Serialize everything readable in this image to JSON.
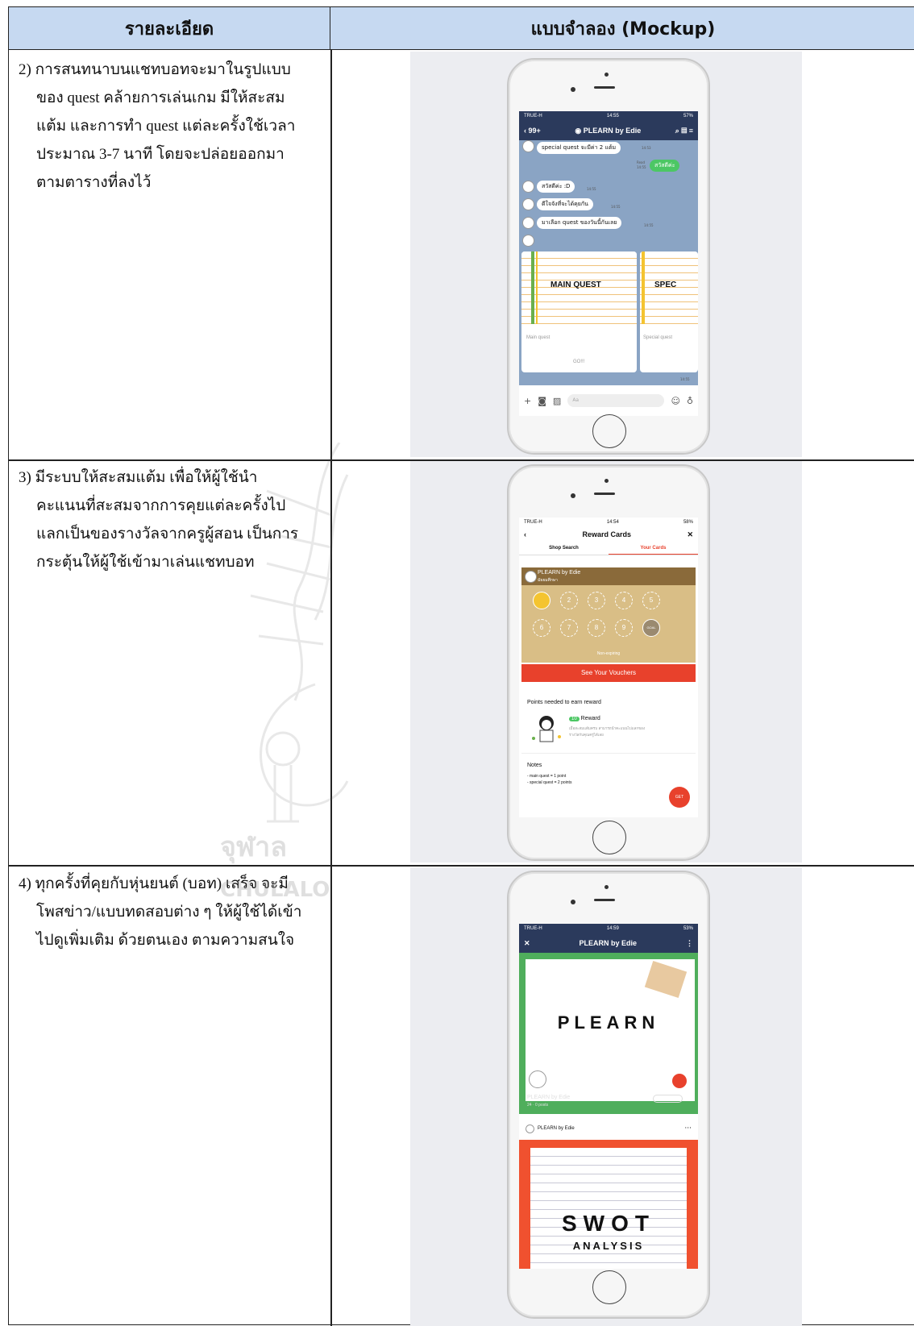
{
  "table": {
    "header_detail": "รายละเอียด",
    "header_mockup": "แบบจำลอง (Mockup)"
  },
  "rows": [
    {
      "lines": [
        "2) การสนทนาบนแชทบอทจะมาในรูปแบบ",
        "ของ quest คล้ายการเล่นเกม มีให้สะสม",
        "แต้ม และการทำ quest แต่ละครั้งใช้เวลา",
        "ประมาณ 3-7 นาที โดยจะปล่อยออกมา",
        "ตามตารางที่ลงไว้"
      ]
    },
    {
      "lines": [
        "3) มีระบบให้สะสมแต้ม เพื่อให้ผู้ใช้นำ",
        "คะแนนที่สะสมจากการคุยแต่ละครั้งไป",
        "แลกเป็นของรางวัลจากครูผู้สอน เป็นการ",
        "กระตุ้นให้ผู้ใช้เข้ามาเล่นแชทบอท"
      ]
    },
    {
      "lines": [
        "4) ทุกครั้งที่คุยกับหุ่นยนต์ (บอท) เสร็จ จะมี",
        "โพสข่าว/แบบทดสอบต่าง ๆ ให้ผู้ใช้ได้เข้า",
        "ไปดูเพิ่มเติม ด้วยตนเอง ตามความสนใจ"
      ]
    }
  ],
  "watermark": {
    "thai": "จุฬาล",
    "eng": "CHULALO"
  },
  "phone1": {
    "carrier": "TRUE-H",
    "time": "14:55",
    "battery": "57%",
    "back": "99+",
    "title": "PLEARN by Edie",
    "msg_top": "special quest จะมีค่า 2 แต้ม",
    "msg_top_time": "14:53",
    "msg_sent": "สวัสดีค่ะ",
    "msg_read": "Read",
    "msg_sent_time": "14:55",
    "msg1": "สวัสดีค่ะ :D",
    "msg1_time": "14:55",
    "msg2": "ดีใจจังที่จะได้คุยกัน",
    "msg2_time": "14:55",
    "msg3": "มาเลือก quest ของวันนี้กันเลย",
    "msg3_time": "14:55",
    "card1_title": "MAIN QUEST",
    "card1_sub": "Main quest",
    "card1_btn": "GO!!!",
    "card2_title": "SPEC",
    "card2_sub": "Special quest",
    "card_time": "14:55",
    "input_placeholder": "Aa"
  },
  "phone2": {
    "carrier": "TRUE-H",
    "time": "14:54",
    "battery": "58%",
    "title": "Reward Cards",
    "tab1": "Shop Search",
    "tab2": "Your Cards",
    "shop_name": "PLEARN by Edie",
    "shop_sub": "มัธยมศึกษา",
    "stamps": [
      "2",
      "3",
      "4",
      "5",
      "6",
      "7",
      "8",
      "9",
      "GOAL"
    ],
    "expiry": "Non-expiring",
    "vouchers": "See Your Vouchers",
    "points_title": "Points needed to earn reward",
    "reward_count": "10",
    "reward_label": "Reward",
    "reward_desc1": "เมื่อสะสมแต้มครบ สามารถนำคะแนนไปแลกของ",
    "reward_desc2": "รางวัลกับคุณครูได้เลย",
    "notes_title": "Notes",
    "note1": "- main quest = 1 point",
    "note2": "- special quest = 2 points",
    "qr_label": "GET"
  },
  "phone3": {
    "carrier": "TRUE-H",
    "time": "14:59",
    "battery": "53%",
    "title": "PLEARN by Edie",
    "cover_title": "PLEARN",
    "cover_name": "PLEARN by Edie",
    "cover_stats": "24 · 0 posts",
    "follow": "Following",
    "post_author": "PLEARN by Edie",
    "post_title": "SWOT",
    "post_sub": "ANALYSIS"
  },
  "colors": {
    "header_bg": "#c6d9f1",
    "line_navy": "#2b3a5c",
    "chat_bg": "#8aa4c4",
    "send_green": "#4cc764",
    "reward_red": "#e8412c",
    "card_gold": "#d9be86",
    "cover_green": "#4fae5c",
    "post_orange": "#f0512f"
  }
}
